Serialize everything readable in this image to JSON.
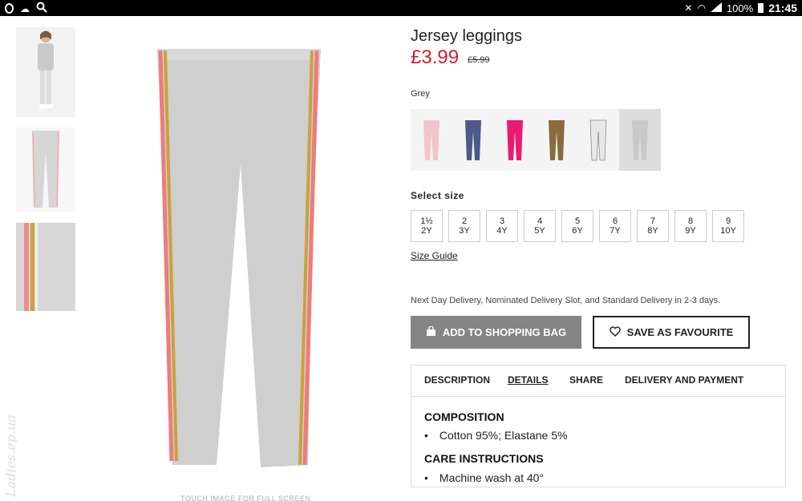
{
  "statusbar": {
    "battery": "100%",
    "time": "21:45"
  },
  "product": {
    "title": "Jersey leggings",
    "price": "£3.99",
    "old_price": "£5.99",
    "color": "Grey",
    "swatch_colors": [
      "#f2c4cc",
      "#4b5a86",
      "#ec1a6f",
      "#8a6a3e",
      "#e8e8e8",
      "#c8c8c8"
    ],
    "select_size_label": "Select size",
    "sizes": [
      {
        "top": "1½",
        "bottom": "2Y"
      },
      {
        "top": "2",
        "bottom": "3Y"
      },
      {
        "top": "3",
        "bottom": "4Y"
      },
      {
        "top": "4",
        "bottom": "5Y"
      },
      {
        "top": "5",
        "bottom": "6Y"
      },
      {
        "top": "6",
        "bottom": "7Y"
      },
      {
        "top": "7",
        "bottom": "8Y"
      },
      {
        "top": "8",
        "bottom": "9Y"
      },
      {
        "top": "9",
        "bottom": "10Y"
      }
    ],
    "size_guide": "Size Guide",
    "delivery": "Next Day Delivery, Nominated Delivery Slot, and Standard Delivery in 2-3 days.",
    "add_to_bag": "ADD TO SHOPPING BAG",
    "save_favourite": "SAVE AS FAVOURITE",
    "touch_note": "TOUCH IMAGE FOR FULL SCREEN",
    "watermark": "Ladies.ep.ua"
  },
  "tabs": {
    "description": "DESCRIPTION",
    "details": "DETAILS",
    "share": "SHARE",
    "delivery": "DELIVERY AND PAYMENT"
  },
  "details": {
    "composition_title": "COMPOSITION",
    "composition": "Cotton 95%; Elastane 5%",
    "care_title": "CARE INSTRUCTIONS",
    "care": "Machine wash at 40°"
  },
  "icons": {
    "bag": "shopping-bag-icon",
    "heart": "heart-icon"
  }
}
